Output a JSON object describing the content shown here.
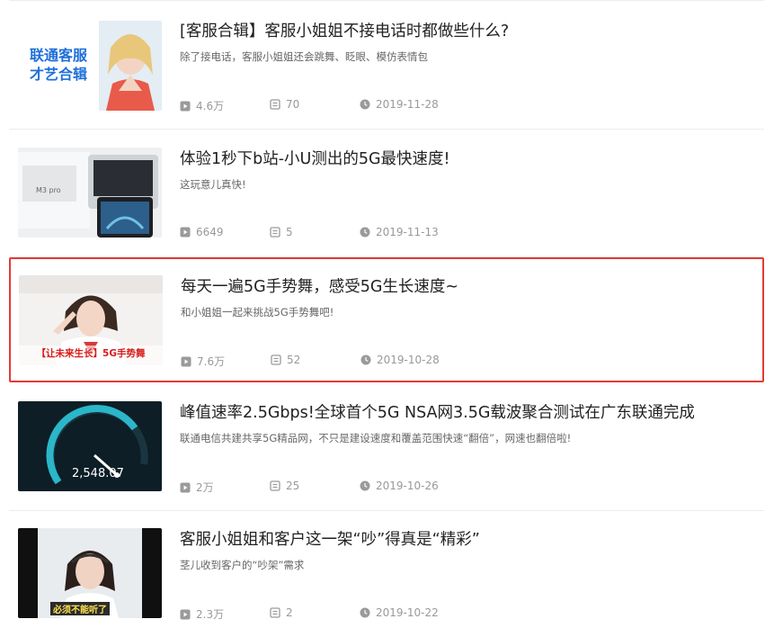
{
  "items": [
    {
      "title": "[客服合辑】客服小姐姐不接电话时都做些什么?",
      "desc": "除了接电话，客服小姐姐还会跳舞、眨眼、模仿表情包",
      "views": "4.6万",
      "comments": "70",
      "date": "2019-11-28",
      "thumb_text": [
        "联通客服",
        "才艺合辑"
      ]
    },
    {
      "title": "体验1秒下b站-小U测出的5G最快速度!",
      "desc": "这玩意儿真快!",
      "views": "6649",
      "comments": "5",
      "date": "2019-11-13",
      "thumb_text": [
        "M3 pro"
      ]
    },
    {
      "title": "每天一遍5G手势舞，感受5G生长速度~",
      "desc": "和小姐姐一起来挑战5G手势舞吧!",
      "views": "7.6万",
      "comments": "52",
      "date": "2019-10-28",
      "thumb_text": [
        "【让未来生长】5G手势舞"
      ]
    },
    {
      "title": "峰值速率2.5Gbps!全球首个5G NSA网3.5G载波聚合测试在广东联通完成",
      "desc": "联通电信共建共享5G精品网，不只是建设速度和覆盖范围快速“翻倍”，网速也翻倍啦!",
      "views": "2万",
      "comments": "25",
      "date": "2019-10-26",
      "thumb_text": [
        "2,548.07"
      ]
    },
    {
      "title": "客服小姐姐和客户这一架“吵”得真是“精彩”",
      "desc": "茎儿收到客户的“吵架”需求",
      "views": "2.3万",
      "comments": "2",
      "date": "2019-10-22",
      "thumb_text": [
        "必须不能听了"
      ]
    }
  ],
  "icons": {
    "views": "play-icon",
    "comments": "comment-icon",
    "date": "clock-icon"
  },
  "colors": {
    "highlight": "#e53935",
    "meta": "#999999",
    "divider": "#ececec"
  }
}
